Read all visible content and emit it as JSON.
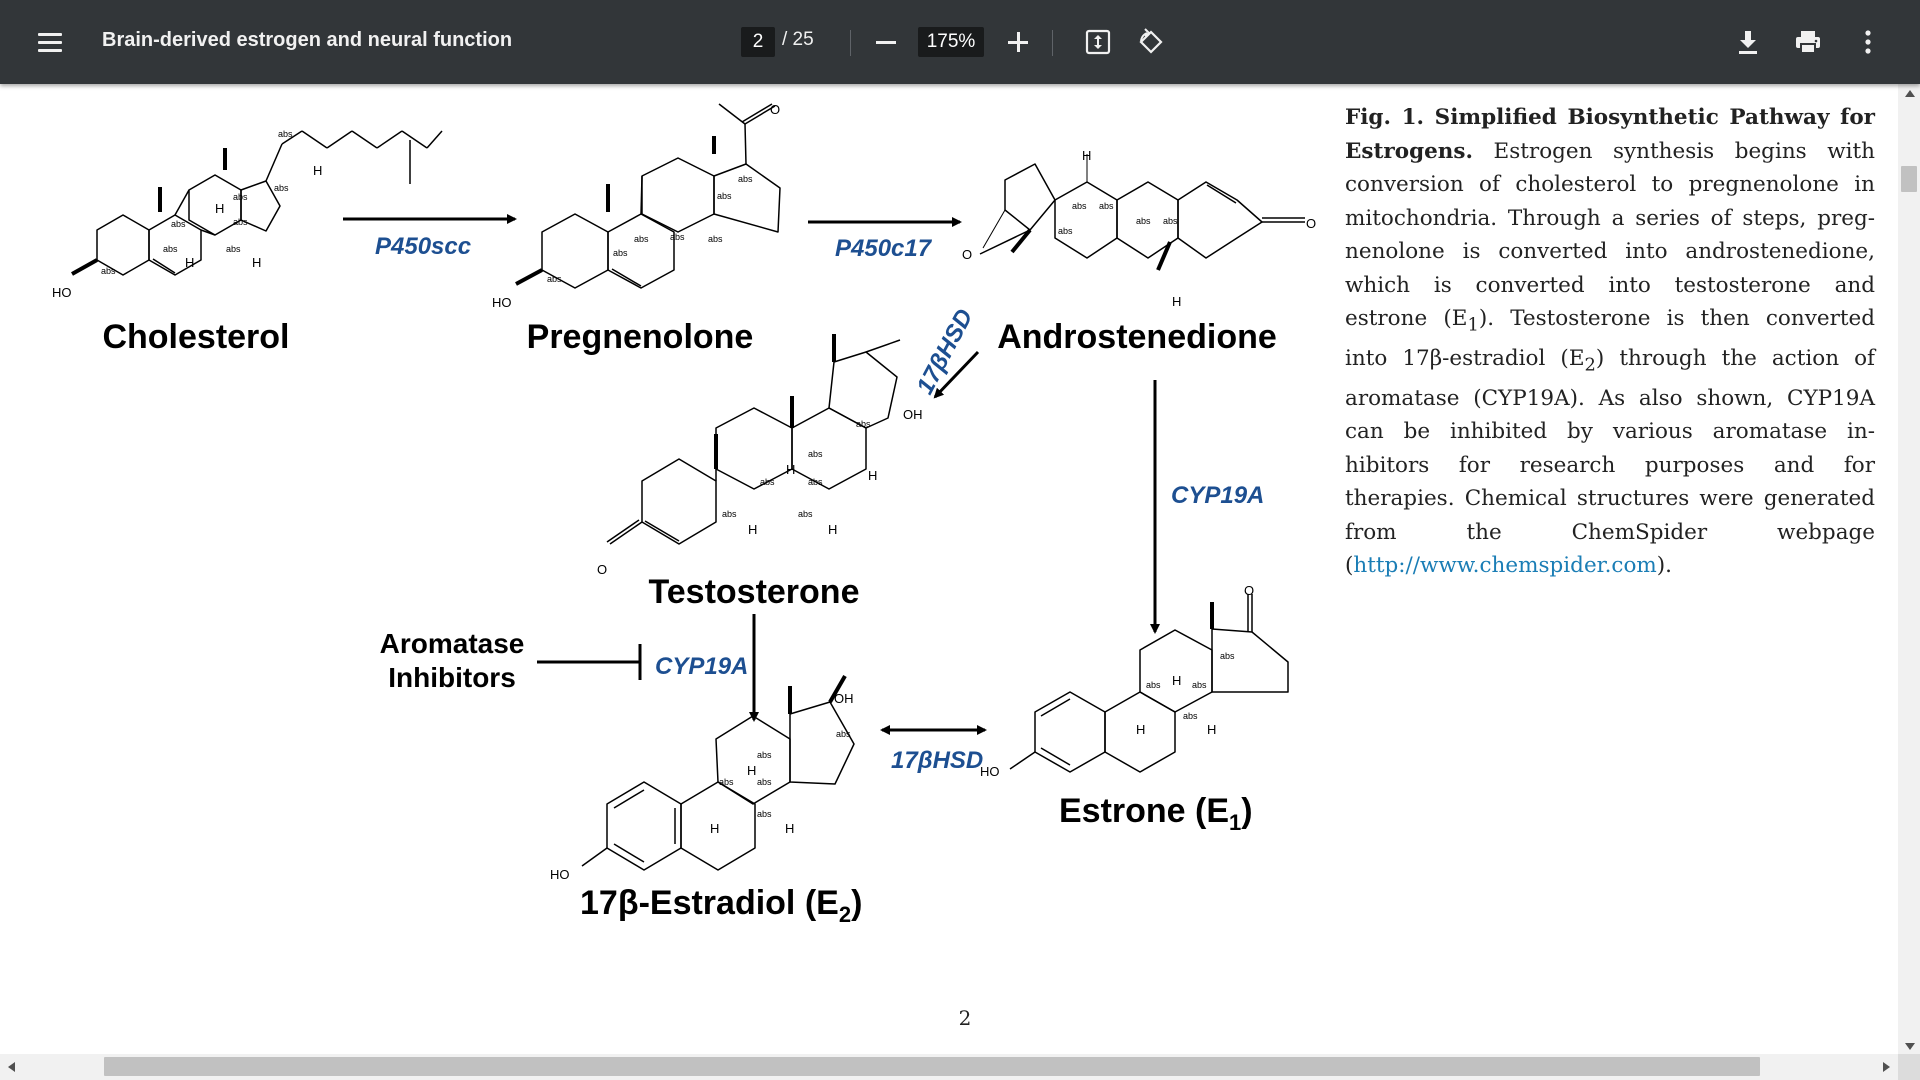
{
  "toolbar": {
    "menu_icon": "hamburger-menu-icon",
    "title": "Brain-derived estrogen and neural function",
    "page_current": "2",
    "page_total": "/ 25",
    "zoom": "175%",
    "icons": [
      "zoom-out-icon",
      "zoom-in-icon",
      "fit-to-page-icon",
      "rotate-icon",
      "download-icon",
      "print-icon",
      "more-options-icon"
    ]
  },
  "figure": {
    "molecules": {
      "cholesterol": "Cholesterol",
      "pregnenolone": "Pregnenolone",
      "androstenedione": "Androstenedione",
      "testosterone": "Testosterone",
      "estradiol": "17β-Estradiol (E",
      "estradiol_sub": "2",
      "estrone": "Estrone (E",
      "estrone_sub": "1"
    },
    "enzymes": {
      "p450scc": "P450scc",
      "p450c17": "P450c17",
      "hsd_diag": "17βHSD",
      "cyp19a_right": "CYP19A",
      "cyp19a_left": "CYP19A",
      "hsd_bottom": "17βHSD"
    },
    "inhibitor": {
      "line1": "Aromatase",
      "line2": "Inhibitors"
    },
    "atom_labels": {
      "abs": "abs",
      "h": "H",
      "ho": "HO",
      "oh": "OH",
      "o": "O"
    }
  },
  "caption": {
    "fig_label": "Fig. 1. Simplified Biosynthetic Pathway for Estrogens.",
    "text_before_e1": " Estrogen synthesis begins with conversion of cholesterol to pregnenolone in mitochondria. Through a series of steps, preg-nenolone is converted into androstenedione, which is converted into testosterone and estrone (E",
    "sub_1": "1",
    "text_mid": "). Testosterone is then converted into 17β-estradiol (E",
    "sub_2": "2",
    "text_after": ") through the action of aromatase (CYP19A). As also shown, CYP19A can be inhibited by various aromatase in-hibitors for research purposes and for therapies. Chemical structures were generated from the ChemSpider webpage (",
    "link": "http://www.chemspider.com",
    "text_end": ")."
  },
  "page_number": "2",
  "colors": {
    "toolbar_bg": "#323639",
    "enzyme_blue": "#1d4f91",
    "link_blue": "#1a7db5"
  }
}
